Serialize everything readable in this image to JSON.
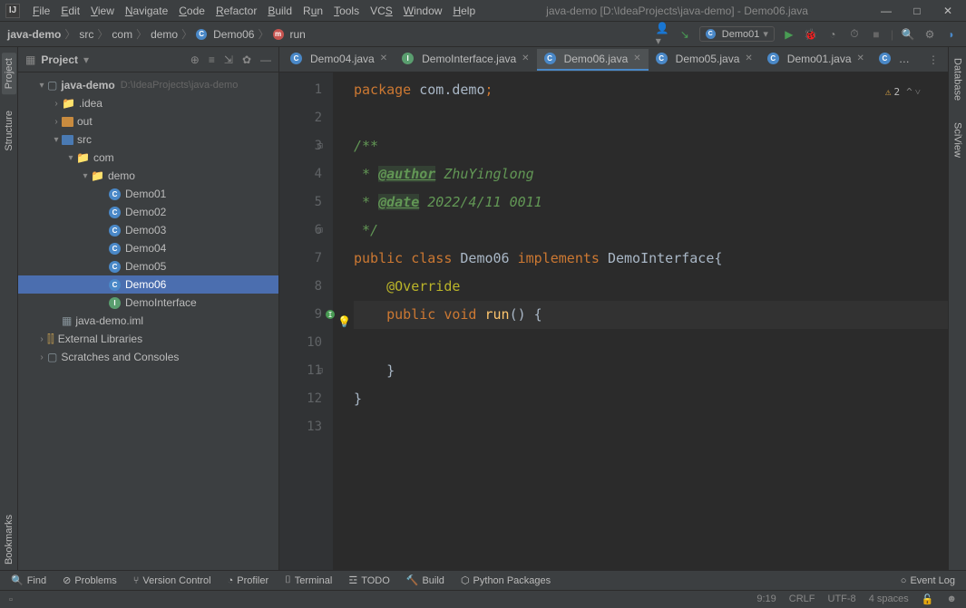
{
  "title": "java-demo [D:\\IdeaProjects\\java-demo] - Demo06.java",
  "menu": [
    "File",
    "Edit",
    "View",
    "Navigate",
    "Code",
    "Refactor",
    "Build",
    "Run",
    "Tools",
    "VCS",
    "Window",
    "Help"
  ],
  "breadcrumb": {
    "project": "java-demo",
    "src": "src",
    "com": "com",
    "demo": "demo",
    "class": "Demo06",
    "method": "run"
  },
  "run_config": "Demo01",
  "left_tabs": {
    "project": "Project",
    "structure": "Structure",
    "bookmarks": "Bookmarks"
  },
  "right_tabs": {
    "database": "Database",
    "sciview": "SciView"
  },
  "project_panel": {
    "title": "Project",
    "root": "java-demo",
    "root_path": "D:\\IdeaProjects\\java-demo",
    "idea": ".idea",
    "out": "out",
    "src": "src",
    "com": "com",
    "demo": "demo",
    "files": [
      "Demo01",
      "Demo02",
      "Demo03",
      "Demo04",
      "Demo05",
      "Demo06",
      "DemoInterface"
    ],
    "iml": "java-demo.iml",
    "external": "External Libraries",
    "scratches": "Scratches and Consoles"
  },
  "tabs": [
    {
      "name": "Demo04.java",
      "active": false
    },
    {
      "name": "DemoInterface.java",
      "active": false
    },
    {
      "name": "Demo06.java",
      "active": true
    },
    {
      "name": "Demo05.java",
      "active": false
    },
    {
      "name": "Demo01.java",
      "active": false
    }
  ],
  "code": {
    "l1_a": "package ",
    "l1_b": "com.demo",
    "l1_c": ";",
    "l3": "/**",
    "l4_a": " * ",
    "l4_b": "@author",
    "l4_c": " ZhuYinglong",
    "l5_a": " * ",
    "l5_b": "@date",
    "l5_c": " 2022/4/11 0011",
    "l6": " */",
    "l7_a": "public class ",
    "l7_b": "Demo06 ",
    "l7_c": "implements ",
    "l7_d": "DemoInterface{",
    "l8": "    @Override",
    "l9_a": "    ",
    "l9_b": "public ",
    "l9_c": "void ",
    "l9_d": "run",
    "l9_e": "() {",
    "l11": "    }",
    "l12": "}"
  },
  "warnings": "2",
  "bottom": {
    "find": "Find",
    "problems": "Problems",
    "vcs": "Version Control",
    "profiler": "Profiler",
    "terminal": "Terminal",
    "todo": "TODO",
    "build": "Build",
    "python": "Python Packages",
    "eventlog": "Event Log"
  },
  "status": {
    "pos": "9:19",
    "eol": "CRLF",
    "enc": "UTF-8",
    "indent": "4 spaces"
  }
}
